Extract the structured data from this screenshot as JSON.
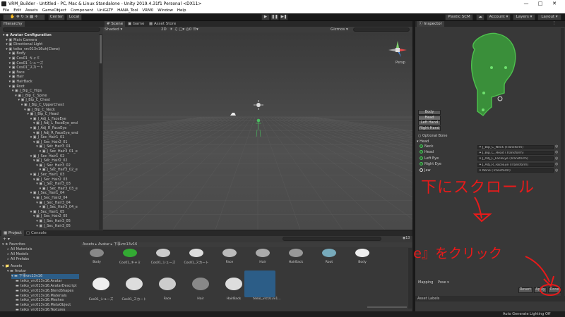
{
  "window": {
    "title": "VRM_Builder - Untitled - PC, Mac & Linux Standalone - Unity 2019.4.31f1 Personal <DX11>"
  },
  "menu": [
    "File",
    "Edit",
    "Assets",
    "GameObject",
    "Component",
    "UniGLTF",
    "HANA_Tool",
    "VRM0",
    "Window",
    "Help"
  ],
  "toolbar": {
    "center": "Center",
    "local": "Local",
    "plastic": "Plastic SCM",
    "account": "Account",
    "layers": "Layers",
    "layout": "Layout"
  },
  "hierarchy": {
    "tab": "Hierarchy",
    "search_placeholder": "All",
    "items": [
      {
        "label": "Avatar Configuration",
        "indent": 0,
        "bold": true
      },
      {
        "label": "Main Camera",
        "indent": 1
      },
      {
        "label": "Directional Light",
        "indent": 1
      },
      {
        "label": "teiko_vrc013v16uh(Clone)",
        "indent": 1
      },
      {
        "label": "Body",
        "indent": 2
      },
      {
        "label": "Cos01_キャミ",
        "indent": 2
      },
      {
        "label": "Cos01_シューズ",
        "indent": 2
      },
      {
        "label": "Cos01_スカート",
        "indent": 2
      },
      {
        "label": "Face",
        "indent": 2
      },
      {
        "label": "Hair",
        "indent": 2
      },
      {
        "label": "HairBack",
        "indent": 2
      },
      {
        "label": "Root",
        "indent": 2
      },
      {
        "label": "J_Bip_C_Hips",
        "indent": 3
      },
      {
        "label": "J_Bip_C_Spine",
        "indent": 4
      },
      {
        "label": "J_Bip_C_Chest",
        "indent": 5
      },
      {
        "label": "J_Bip_C_UpperChest",
        "indent": 6
      },
      {
        "label": "J_Bip_C_Neck",
        "indent": 7
      },
      {
        "label": "J_Bip_C_Head",
        "indent": 8
      },
      {
        "label": "J_Adj_L_FaceEye",
        "indent": 9
      },
      {
        "label": "J_Adj_L_FaceEye_end",
        "indent": 10
      },
      {
        "label": "J_Adj_R_FaceEye",
        "indent": 9
      },
      {
        "label": "J_Adj_R_FaceEye_end",
        "indent": 10
      },
      {
        "label": "J_Sec_Hair1_01",
        "indent": 9
      },
      {
        "label": "J_Sec_Hair2_01",
        "indent": 10
      },
      {
        "label": "J_Sec_Hair3_01",
        "indent": 11
      },
      {
        "label": "J_Sec_Hair3_01_e",
        "indent": 12
      },
      {
        "label": "J_Sec_Hair1_02",
        "indent": 9
      },
      {
        "label": "J_Sec_Hair2_02",
        "indent": 10
      },
      {
        "label": "J_Sec_Hair3_02",
        "indent": 11
      },
      {
        "label": "J_Sec_Hair3_02_e",
        "indent": 12
      },
      {
        "label": "J_Sec_Hair1_03",
        "indent": 9
      },
      {
        "label": "J_Sec_Hair2_03",
        "indent": 10
      },
      {
        "label": "J_Sec_Hair3_03",
        "indent": 11
      },
      {
        "label": "J_Sec_Hair3_03_e",
        "indent": 12
      },
      {
        "label": "J_Sec_Hair1_04",
        "indent": 9
      },
      {
        "label": "J_Sec_Hair2_04",
        "indent": 10
      },
      {
        "label": "J_Sec_Hair3_04",
        "indent": 11
      },
      {
        "label": "J_Sec_Hair3_04_e",
        "indent": 12
      },
      {
        "label": "J_Sec_Hair1_05",
        "indent": 9
      },
      {
        "label": "J_Sec_Hair2_05",
        "indent": 10
      },
      {
        "label": "J_Sec_Hair3_05",
        "indent": 11
      },
      {
        "label": "J_Sec_Hair3_05",
        "indent": 11
      }
    ]
  },
  "scene": {
    "tabs": [
      "Scene",
      "Game",
      "Asset Store"
    ],
    "shading": "Shaded",
    "mode": "2D",
    "gizmos": "Gizmos",
    "search_placeholder": "All",
    "persp": "Persp"
  },
  "inspector": {
    "tab": "Inspector",
    "body_buttons": [
      "Body",
      "Head",
      "Left Hand",
      "Right Hand"
    ],
    "optional_bone": "Optional Bone",
    "section": "Head",
    "bones": [
      {
        "label": "Neck",
        "value": "J_Bip_C_Neck (Transform)"
      },
      {
        "label": "Head",
        "value": "J_Bip_C_Head (Transform)"
      },
      {
        "label": "Left Eye",
        "value": "J_Adj_L_FaceEye (Transform)"
      },
      {
        "label": "Right Eye",
        "value": "J_Adj_R_FaceEye (Transform)"
      },
      {
        "label": "Jaw",
        "value": "None (Transform)"
      }
    ],
    "mapping": "Mapping",
    "pose": "Pose",
    "revert": "Revert",
    "apply": "Apply",
    "done": "Done",
    "asset_labels": "Asset Labels"
  },
  "project": {
    "tabs": [
      "Project",
      "Console"
    ],
    "favorites": "Favorites",
    "fav_items": [
      "All Materials",
      "All Models",
      "All Prefabs"
    ],
    "assets": "Assets",
    "tree": [
      "Avatar",
      "下事vrc13v16",
      "teiko_vrc013v16.Avatar",
      "teiko_vrc013v16.AvatarDescript",
      "teiko_vrc013v16.BlendShapes",
      "teiko_vrc013v16.Materials",
      "teiko_vrc013v16.Meshes",
      "teiko_vrc013v16.MetaObject",
      "teiko_vrc013v16.Textures"
    ],
    "breadcrumb": [
      "Assets",
      "Avatar",
      "下事vrc13v16"
    ],
    "search_count": "13",
    "row1": [
      "Body",
      "Cos01_キャミ",
      "Cos01_シューズ",
      "Cos01_スカート",
      "Face",
      "Hair",
      "HairBack",
      "Root",
      "Body"
    ],
    "row2": [
      "Cos01_シューズ",
      "Cos01_スカート",
      "Face",
      "Hair",
      "HairBack",
      "teiko_vrc013v1..."
    ]
  },
  "annotations": {
    "scroll": "下にスクロール",
    "done": "『Done』をクリック"
  },
  "status": {
    "right": "Auto Generate Lighting Off"
  },
  "colors": {
    "accent": "#44c26a",
    "annotation": "#e81a1a",
    "selection": "#2c5d87"
  }
}
